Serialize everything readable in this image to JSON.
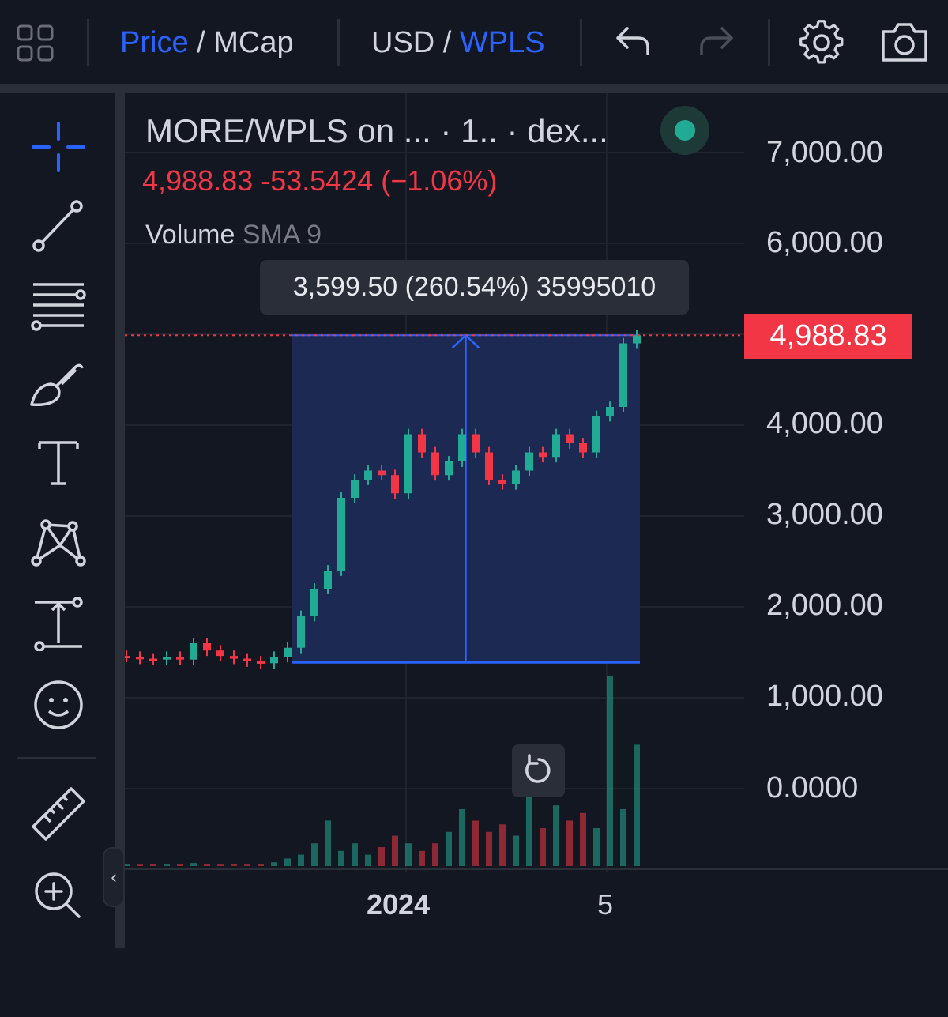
{
  "toolbar": {
    "price_label": "Price",
    "price_sep": " / ",
    "mcap_label": "MCap",
    "usd_label": "USD",
    "pair_sep": " / ",
    "wpls_label": "WPLS"
  },
  "legend": {
    "title": "MORE/WPLS on ... · 1.. · dex...",
    "price": "4,988.83  -53.5424 (−1.06%)",
    "volume_label": "Volume",
    "volume_ma": "SMA 9"
  },
  "measure": {
    "tooltip": "3,599.50 (260.54%) 35995010"
  },
  "price_axis": {
    "current_price": "4,988.83",
    "ticks": [
      "7,000.00",
      "6,000.00",
      "4,000.00",
      "3,000.00",
      "2,000.00",
      "1,000.00",
      "0.0000"
    ]
  },
  "time_axis": {
    "labels": [
      "2024",
      "5"
    ]
  },
  "colors": {
    "accent": "#2962ff",
    "up": "#22ab94",
    "down": "#f23645",
    "measure_fill": "#1c2a55"
  },
  "icons": {
    "layout": "grid-icon",
    "undo": "undo-icon",
    "redo": "redo-icon",
    "settings": "gear-icon",
    "snapshot": "camera-icon",
    "crosshair": "crosshair-icon",
    "trendline": "trend-line-icon",
    "fib": "fib-retracement-icon",
    "brush": "brush-icon",
    "text": "text-icon",
    "pattern": "pattern-icon",
    "measure": "price-range-icon",
    "emoji": "smiley-icon",
    "ruler": "ruler-icon",
    "zoom": "zoom-in-icon",
    "reset": "reset-chart-icon",
    "collapse": "chevron-left-icon"
  },
  "chart_data": {
    "type": "candlestick",
    "y_axis_range": [
      0,
      7000
    ],
    "price_series_approx_close": [
      1450,
      1430,
      1420,
      1450,
      1420,
      1600,
      1520,
      1460,
      1430,
      1400,
      1380,
      1450,
      1550,
      1900,
      2200,
      2400,
      3200,
      3400,
      3500,
      3450,
      3250,
      3900,
      3700,
      3450,
      3600,
      3900,
      3700,
      3400,
      3350,
      3500,
      3700,
      3650,
      3900,
      3800,
      3700,
      4100,
      4200,
      4900,
      4988.83
    ],
    "measure_range": {
      "from": 1389.33,
      "to": 4988.83,
      "change": 3599.5,
      "change_pct": 260.54
    },
    "volume_series_relative": [
      2,
      2,
      3,
      2,
      3,
      4,
      3,
      2,
      3,
      2,
      3,
      5,
      10,
      15,
      30,
      60,
      20,
      30,
      15,
      25,
      40,
      30,
      20,
      30,
      45,
      75,
      60,
      45,
      55,
      40,
      95,
      50,
      80,
      60,
      70,
      50,
      250,
      75,
      160
    ]
  }
}
